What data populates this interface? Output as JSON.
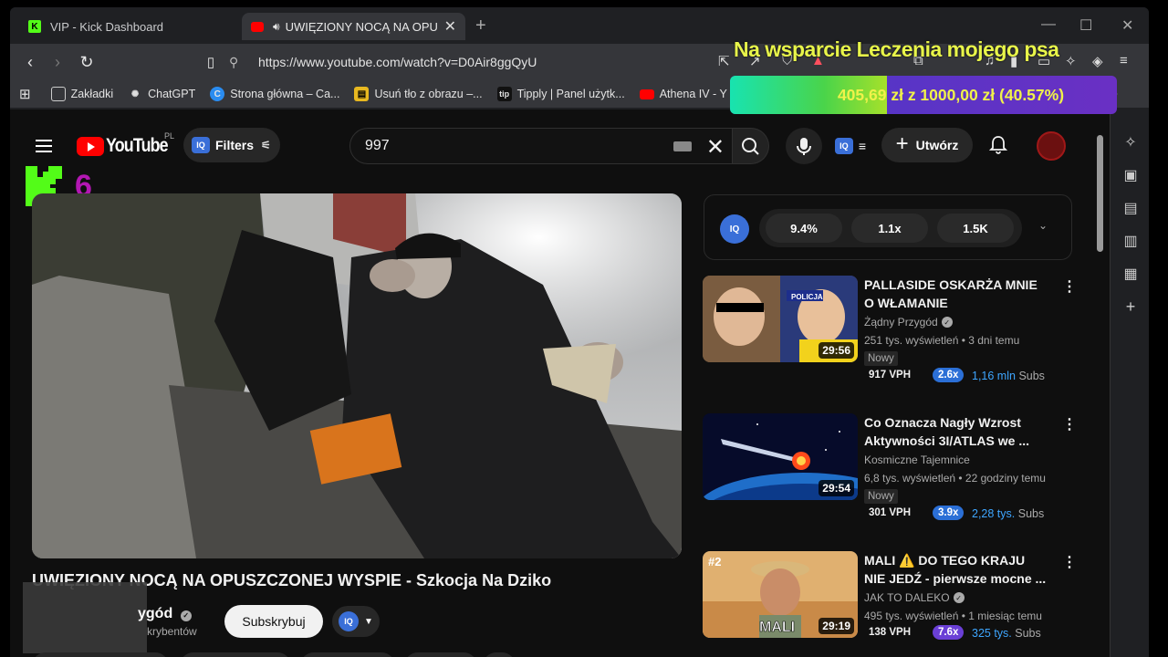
{
  "browser": {
    "tabs": [
      {
        "title": "VIP - Kick Dashboard",
        "active": false
      },
      {
        "title": "UWIĘZIONY NOCĄ NA OPUSZCZONEJ",
        "active": true
      }
    ],
    "url": "https://www.youtube.com/watch?v=D0Air8ggQyU",
    "bookmarks": [
      {
        "label": "Zakładki"
      },
      {
        "label": "ChatGPT"
      },
      {
        "label": "Strona główna – Ca..."
      },
      {
        "label": "Usuń tło z obrazu –..."
      },
      {
        "label": "Tipply | Panel użytk..."
      },
      {
        "label": "Athena IV - Y"
      }
    ],
    "more_bookmarks": "»"
  },
  "overlay": {
    "title": "Na wsparcie Leczenia mojego psa",
    "progress_text": "405,69 zł z 1000,00 zł (40.57%)",
    "progress_fraction": 0.4057
  },
  "youtube": {
    "logo_text": "YouTube",
    "region": "PL",
    "filters_label": "Filters",
    "search_value": "997",
    "create_label": "Utwórz",
    "k_counter": "6",
    "video": {
      "title": "UWIĘZIONY NOCĄ NA OPUSZCZONEJ WYSPIE - Szkocja Na Dziko",
      "channel": "ygód",
      "subscribers": "krybentów",
      "subscribe_label": "Subskrybuj"
    },
    "stats": {
      "iq": "IQ",
      "values": [
        "9.4%",
        "1.1x",
        "1.5K"
      ]
    },
    "recommendations": [
      {
        "title": "PALLASIDE OSKARŻA MNIE O WŁAMANIE",
        "channel": "Żądny Przygód",
        "meta": "251 tys. wyświetleń • 3 dni temu",
        "duration": "29:56",
        "badge": "Nowy",
        "vph": "917 VPH",
        "mult": "2.6x",
        "mult_color": "#2b6fd6",
        "subs_num": "1,16 mln",
        "subs_label": "Subs",
        "thumb_text": "POLICJA"
      },
      {
        "title": "Co Oznacza Nagły Wzrost Aktywności 3I/ATLAS we ...",
        "channel": "Kosmiczne Tajemnice",
        "meta": "6,8 tys. wyświetleń • 22 godziny temu",
        "duration": "29:54",
        "badge": "Nowy",
        "vph": "301 VPH",
        "mult": "3.9x",
        "mult_color": "#2b6fd6",
        "subs_num": "2,28 tys.",
        "subs_label": "Subs"
      },
      {
        "title": "MALI ⚠️ DO TEGO KRAJU NIE JEDŹ - pierwsze mocne ...",
        "channel": "JAK TO DALEKO",
        "meta": "495 tys. wyświetleń • 1 miesiąc temu",
        "duration": "29:19",
        "vph": "138 VPH",
        "mult": "7.6x",
        "mult_color": "#6a3fd6",
        "subs_num": "325 tys.",
        "subs_label": "Subs",
        "thumb_rank": "#2",
        "thumb_text": "MALI"
      }
    ]
  }
}
